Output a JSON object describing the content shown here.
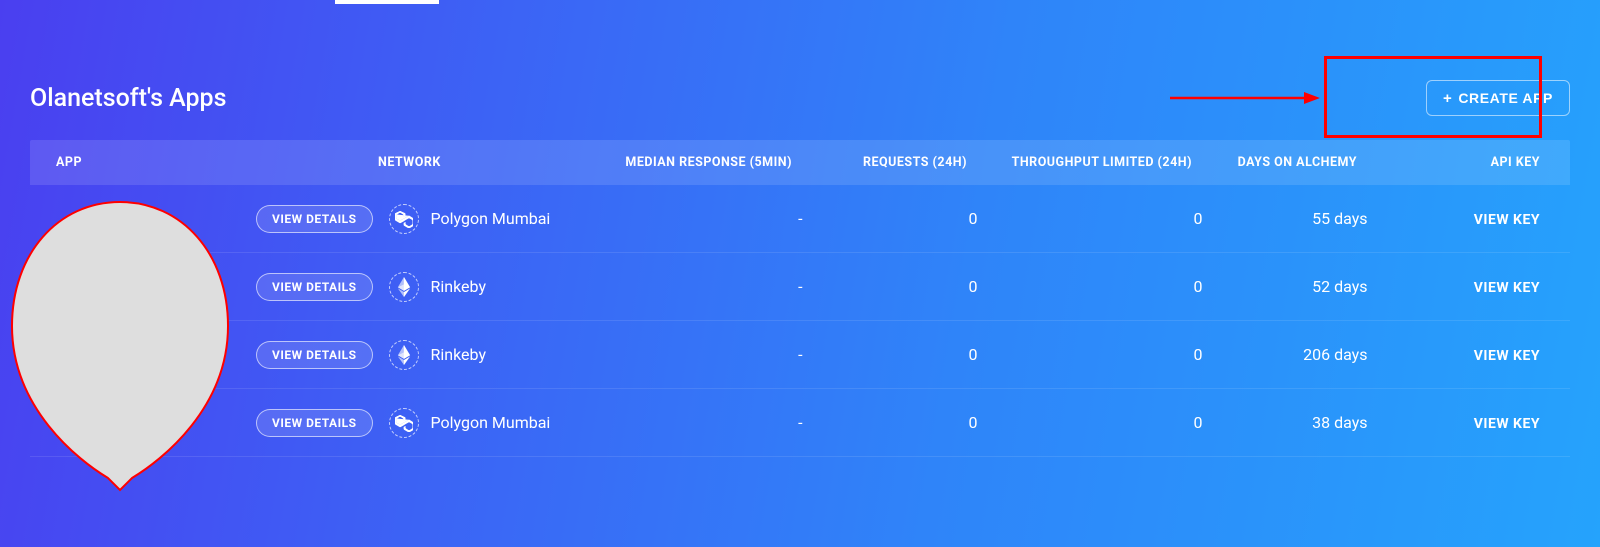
{
  "header": {
    "title": "Olanetsoft's Apps",
    "create_label": "CREATE APP"
  },
  "table": {
    "columns": {
      "app": "APP",
      "network": "NETWORK",
      "median": "MEDIAN RESPONSE (5MIN)",
      "requests": "REQUESTS (24H)",
      "throughput": "THROUGHPUT LIMITED (24H)",
      "days": "DAYS ON ALCHEMY",
      "apikey": "API KEY"
    },
    "view_details_label": "VIEW DETAILS",
    "view_key_label": "VIEW KEY",
    "rows": [
      {
        "network": "Polygon Mumbai",
        "net_icon": "polygon",
        "median": "-",
        "requests": "0",
        "throughput": "0",
        "days": "55 days"
      },
      {
        "network": "Rinkeby",
        "net_icon": "eth",
        "median": "-",
        "requests": "0",
        "throughput": "0",
        "days": "52 days"
      },
      {
        "network": "Rinkeby",
        "net_icon": "eth",
        "median": "-",
        "requests": "0",
        "throughput": "0",
        "days": "206 days"
      },
      {
        "network": "Polygon Mumbai",
        "net_icon": "polygon",
        "median": "-",
        "requests": "0",
        "throughput": "0",
        "days": "38 days"
      }
    ]
  }
}
